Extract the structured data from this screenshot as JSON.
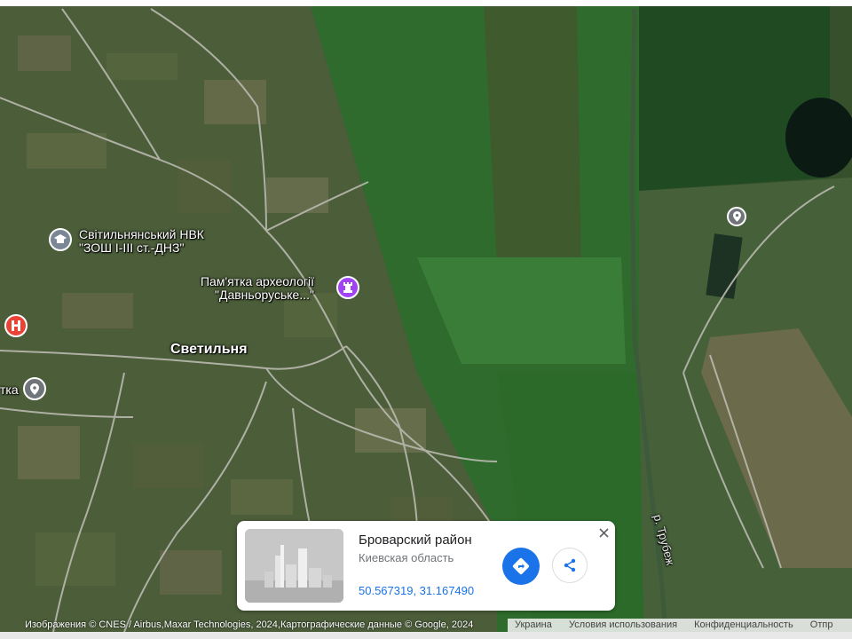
{
  "map": {
    "type": "satellite",
    "labels": {
      "school": [
        "Світильнянський НВК",
        "\"ЗОШ I-III ст.-ДНЗ\""
      ],
      "monument": [
        "Пам'ятка археології",
        "\"Давньоруське...\""
      ],
      "town": "Светильня",
      "left_partial": "тка",
      "river": "р. Трубеж"
    },
    "icons": {
      "school_pin": "school-icon",
      "monument_pin": "chess-rook-icon",
      "hospital_pin": "hospital-icon",
      "place_pin": "location-pin-icon",
      "place_pin_right": "location-pin-icon"
    },
    "colors": {
      "school_pin": "#7b8794",
      "monument_pin": "#a142f4",
      "hospital_pin": "#ea4335",
      "place_pin": "#70757a"
    }
  },
  "info_card": {
    "title": "Броварский район",
    "subtitle": "Киевская область",
    "coordinates": "50.567319, 31.167490",
    "directions_icon": "directions-icon",
    "share_icon": "share-icon",
    "close_icon": "close-icon"
  },
  "footer": {
    "attribution": "Изображения © CNES / Airbus,Maxar Technologies, 2024,Картографические данные © Google, 2024",
    "links": [
      "Украина",
      "Условия использования",
      "Конфиденциальность",
      "Отпр"
    ]
  }
}
